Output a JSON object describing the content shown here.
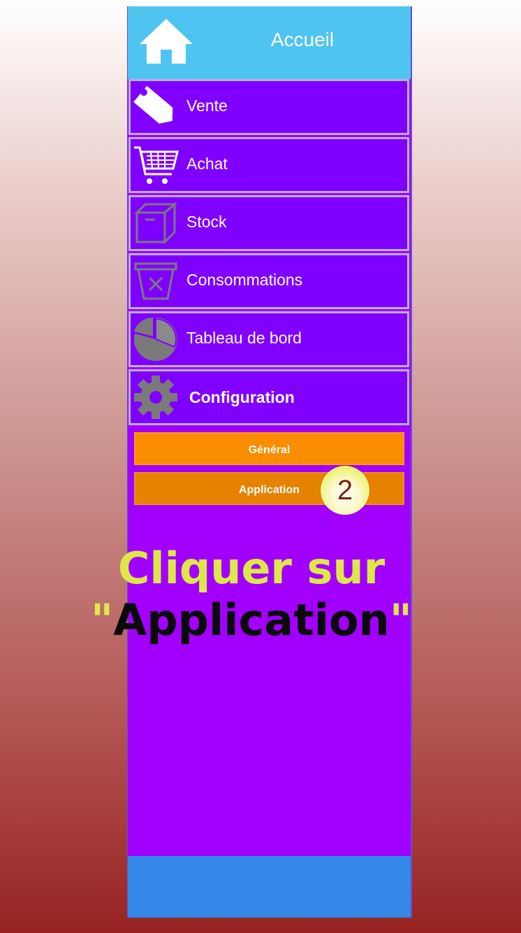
{
  "header": {
    "title": "Accueil",
    "icon": "home-icon"
  },
  "menu": [
    {
      "label": "Vente",
      "icon": "price-tag-icon"
    },
    {
      "label": "Achat",
      "icon": "shopping-cart-icon"
    },
    {
      "label": "Stock",
      "icon": "box-icon"
    },
    {
      "label": "Consommations",
      "icon": "consumption-bin-icon"
    },
    {
      "label": "Tableau de bord",
      "icon": "pie-chart-icon"
    },
    {
      "label": "Configuration",
      "icon": "gear-icon"
    }
  ],
  "submenu": [
    {
      "label": "Général"
    },
    {
      "label": "Application"
    }
  ],
  "step_badge": "2",
  "instruction": {
    "line1": "Cliquer sur",
    "quote_open": "\"",
    "line2": "Application",
    "quote_close": "\""
  },
  "colors": {
    "header": "#4fc4f0",
    "menu_item": "#8000ff",
    "panel": "#a100ff",
    "submenu": "#fa8c00",
    "footer": "#3388ea",
    "instruction_highlight": "#dde848"
  }
}
